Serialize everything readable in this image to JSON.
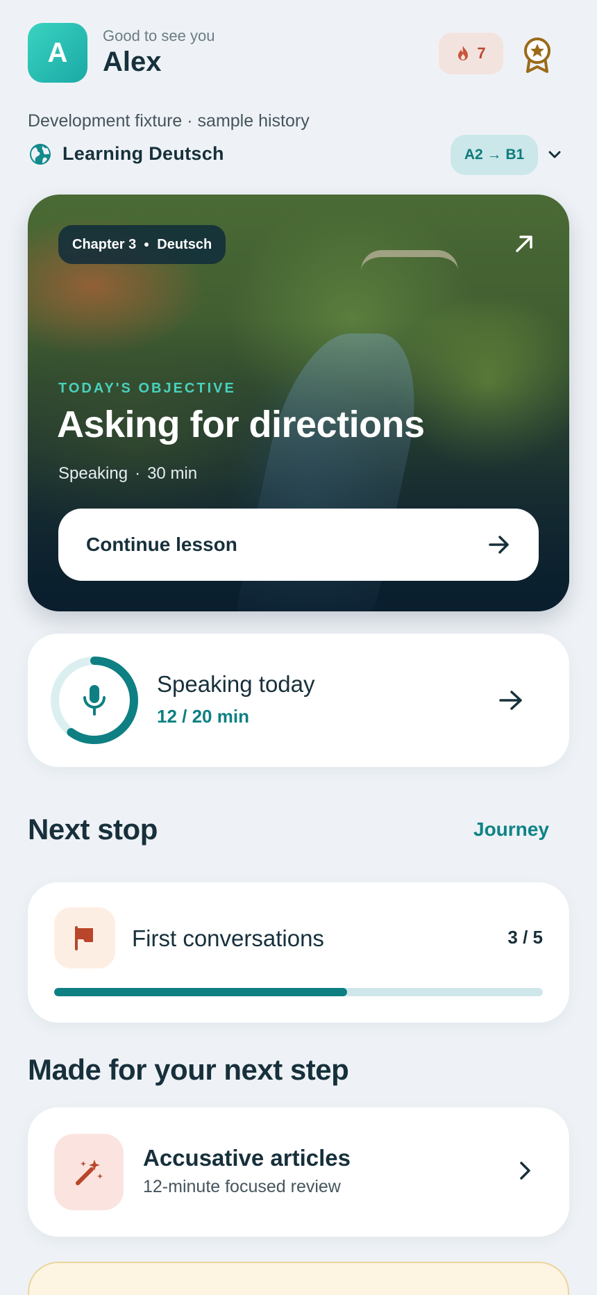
{
  "header": {
    "avatar_letter": "A",
    "greeting": "Good to see you",
    "username": "Alex",
    "streak_count": "7",
    "streak_icon": "flame-icon",
    "award_icon": "award-badge-icon"
  },
  "fixture_note": "Development fixture · sample history",
  "language": {
    "label": "Learning Deutsch",
    "level": "A2 → B1",
    "icon": "globe-icon"
  },
  "hero": {
    "chapter": "Chapter 3",
    "language": "Deutsch",
    "objective_label": "TODAY'S OBJECTIVE",
    "title": "Asking for directions",
    "skill": "Speaking",
    "separator": "·",
    "duration": "30 min",
    "button_label": "Continue lesson"
  },
  "speaking": {
    "title": "Speaking today",
    "value": "12 / 20 min",
    "progress": 0.6
  },
  "next_stop": {
    "heading": "Next stop",
    "link": "Journey",
    "unit_label": "First conversations",
    "count": "3 / 5",
    "progress": 0.6
  },
  "recommended": {
    "heading": "Made for your next step",
    "title": "Accusative articles",
    "subtitle": "12-minute focused review"
  },
  "colors": {
    "accent": "#0e7f82",
    "accent_light": "#48d2bd",
    "streak": "#b9492d",
    "background": "#eef2f6"
  }
}
